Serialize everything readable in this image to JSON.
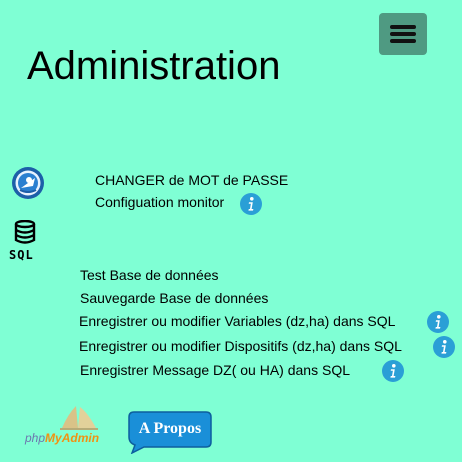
{
  "page": {
    "title": "Administration",
    "menu_icon": "hamburger-menu-icon"
  },
  "top_links": [
    {
      "label": "CHANGER de MOT de PASSE"
    },
    {
      "label": "Configuation monitor"
    }
  ],
  "sql": {
    "icon_label": "SQL",
    "links": [
      {
        "label": "Test Base de données"
      },
      {
        "label": "Sauvegarde Base de données"
      },
      {
        "label": "Enregistrer ou modifier Variables (dz,ha) dans SQL"
      },
      {
        "label": "Enregistrer ou modifier Dispositifs (dz,ha) dans SQL"
      },
      {
        "label": "Enregistrer Message DZ( ou HA) dans SQL"
      }
    ]
  },
  "footer": {
    "phpmyadmin": {
      "php": "php",
      "myadmin": "MyAdmin"
    },
    "apropos_label": "A Propos"
  },
  "colors": {
    "background": "#7fffd4",
    "menu_button": "#4f9a82",
    "info_icon": "#2a9fd6",
    "apropos_bg": "#1a8fd8"
  }
}
